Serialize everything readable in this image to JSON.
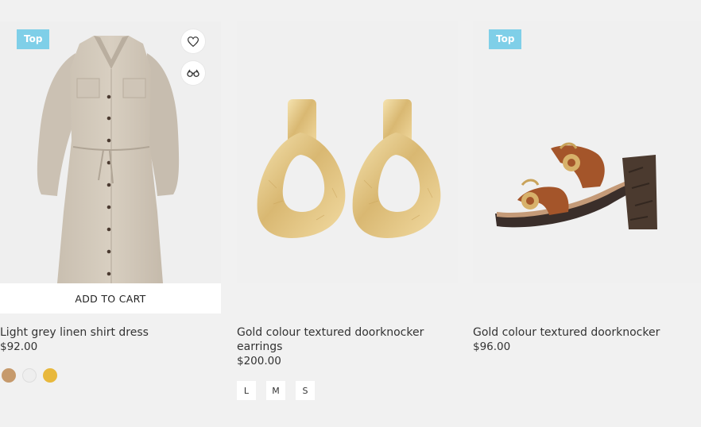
{
  "products": [
    {
      "badge": "Top",
      "name": "Light grey linen shirt dress",
      "price": "$92.00",
      "add_to_cart": "ADD TO CART",
      "image_icon": "shirt-dress-image",
      "actions": [
        "heart-icon",
        "glasses-icon"
      ],
      "swatches": [
        "#c69a6c",
        "#eeeeee",
        "#e8b83c"
      ]
    },
    {
      "name": "Gold colour textured doorknocker earrings",
      "price": "$200.00",
      "image_icon": "earrings-image",
      "sizes": [
        "L",
        "M",
        "S"
      ]
    },
    {
      "badge": "Top",
      "name": "Gold colour textured doorknocker",
      "price": "$96.00",
      "image_icon": "heeled-sandal-image"
    }
  ],
  "colors": {
    "badge": "#7fcfe8",
    "background": "#f1f1f1"
  }
}
